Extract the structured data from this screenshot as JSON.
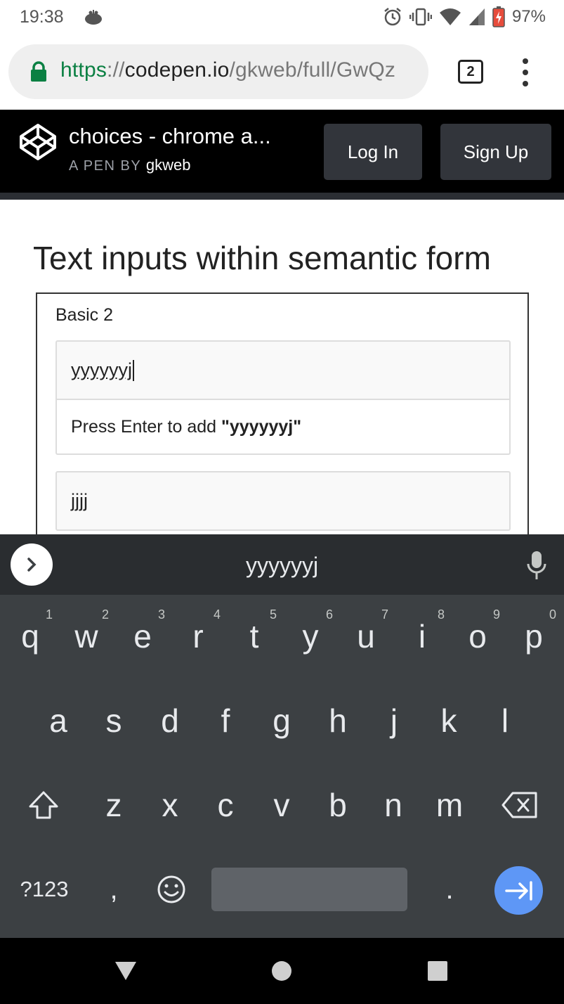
{
  "status_bar": {
    "time": "19:38",
    "battery_percent": "97%",
    "icons": [
      "notification-bug-icon",
      "alarm-icon",
      "vibrate-icon",
      "wifi-icon",
      "signal-icon",
      "battery-charging-icon"
    ]
  },
  "browser": {
    "url": {
      "scheme": "https",
      "separator": "://",
      "host": "codepen.io",
      "path": "/gkweb/full/GwQz"
    },
    "tab_count": "2"
  },
  "codepen_header": {
    "title": "choices - chrome a...",
    "byline_prefix": "A PEN BY",
    "author": "gkweb",
    "login_label": "Log In",
    "signup_label": "Sign Up"
  },
  "page": {
    "heading": "Text inputs within semantic form",
    "form": {
      "label": "Basic 2",
      "input_value": "yyyyyyj",
      "dropdown_prefix": "Press Enter to add ",
      "dropdown_value": "\"yyyyyyj\"",
      "second_input_value": "jjjj"
    }
  },
  "keyboard": {
    "suggestion": "yyyyyyj",
    "row1": [
      {
        "key": "q",
        "hint": "1"
      },
      {
        "key": "w",
        "hint": "2"
      },
      {
        "key": "e",
        "hint": "3"
      },
      {
        "key": "r",
        "hint": "4"
      },
      {
        "key": "t",
        "hint": "5"
      },
      {
        "key": "y",
        "hint": "6"
      },
      {
        "key": "u",
        "hint": "7"
      },
      {
        "key": "i",
        "hint": "8"
      },
      {
        "key": "o",
        "hint": "9"
      },
      {
        "key": "p",
        "hint": "0"
      }
    ],
    "row2": [
      "a",
      "s",
      "d",
      "f",
      "g",
      "h",
      "j",
      "k",
      "l"
    ],
    "row3": [
      "z",
      "x",
      "c",
      "v",
      "b",
      "n",
      "m"
    ],
    "symbols_label": "?123",
    "comma_label": ",",
    "period_label": ".",
    "colors": {
      "background": "#3c4043",
      "enter": "#5e97f6",
      "space": "#5f6368"
    }
  }
}
